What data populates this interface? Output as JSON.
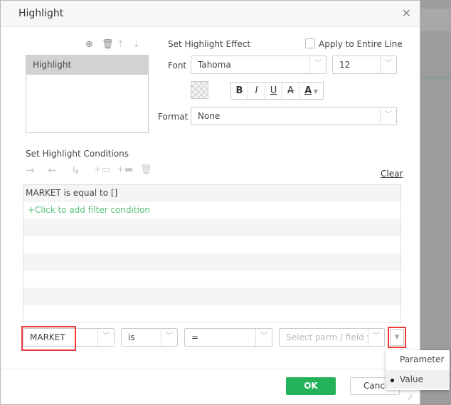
{
  "dialog": {
    "title": "Highlight"
  },
  "highlights": {
    "items": [
      "Highlight"
    ]
  },
  "effect": {
    "section_label": "Set Highlight Effect",
    "apply_entire_line": "Apply to Entire Line",
    "apply_checked": false,
    "font_label": "Font",
    "font_value": "Tahoma",
    "size_value": "12",
    "format_label": "Format",
    "format_value": "None",
    "bold": "B",
    "italic": "I",
    "underline": "U",
    "strike": "A",
    "font_color": "A"
  },
  "conditions": {
    "section_label": "Set Highlight Conditions",
    "clear": "Clear",
    "rows": [
      "MARKET is equal to []"
    ],
    "add_prompt": "+Click to add filter condition"
  },
  "editor": {
    "field": "MARKET",
    "operator": "is",
    "comparator": "=",
    "value_placeholder": "Select parm / field value"
  },
  "menu": {
    "items": [
      "Parameter",
      "Value"
    ],
    "selected": "Value"
  },
  "footer": {
    "ok": "OK",
    "cancel": "Cancel"
  },
  "colors": {
    "ok": "#23b25a",
    "add_prompt": "#5cc07b",
    "highlight_box": "#ef3a3a"
  }
}
